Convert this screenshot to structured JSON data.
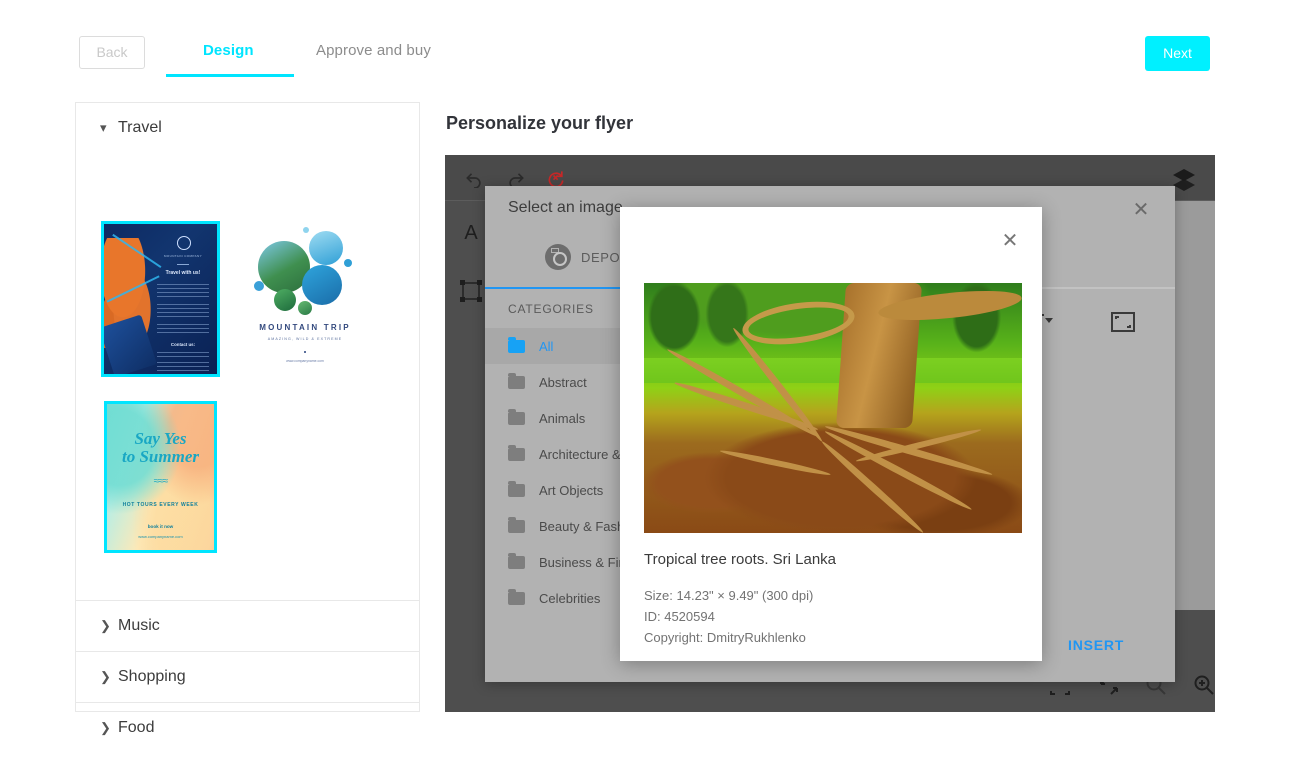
{
  "topbar": {
    "back_label": "Back",
    "tabs": [
      {
        "label": "Design",
        "active": true
      },
      {
        "label": "Approve and buy",
        "active": false
      }
    ],
    "next_label": "Next",
    "accent_color": "#00e5ff"
  },
  "sidebar": {
    "sections": [
      {
        "label": "Travel",
        "expanded": true,
        "caret": "chevron-down-icon"
      },
      {
        "label": "Music",
        "expanded": false,
        "caret": "chevron-right-icon"
      },
      {
        "label": "Shopping",
        "expanded": false,
        "caret": "chevron-right-icon"
      },
      {
        "label": "Food",
        "expanded": false,
        "caret": "chevron-right-icon"
      }
    ],
    "templates": [
      {
        "name": "travel-with-us-flyer",
        "selected": true,
        "headline": "Travel with us!",
        "brand": "MOUNTAIN COMPANY",
        "contact_label": "Contact us:"
      },
      {
        "name": "mountain-trip-flyer",
        "selected": false,
        "title": "MOUNTAIN TRIP",
        "subtitle": "AMAZING, WILD & EXTREME",
        "url": "www.companyname.com"
      },
      {
        "name": "say-yes-to-summer-flyer",
        "selected": true,
        "title_line1": "Say Yes",
        "title_line2": "to Summer",
        "waves": "≈≈≈",
        "tagline": "HOT TOURS EVERY WEEK",
        "cta": "book it now",
        "url": "www.companyname.com"
      }
    ]
  },
  "main": {
    "title": "Personalize your flyer"
  },
  "editor": {
    "tools": [
      {
        "name": "undo-icon",
        "label": "Undo"
      },
      {
        "name": "redo-icon",
        "label": "Redo"
      },
      {
        "name": "reset-icon",
        "label": "Reset",
        "color": "#c62828"
      },
      {
        "name": "text-tool-icon",
        "label": "A"
      },
      {
        "name": "shape-tool-icon",
        "label": "Shape"
      },
      {
        "name": "layers-icon",
        "label": "Layers"
      }
    ],
    "bottom_tools": [
      {
        "name": "fit-to-screen-icon",
        "label": "Fit to screen"
      },
      {
        "name": "shrink-icon",
        "label": "Shrink"
      },
      {
        "name": "zoom-out-icon",
        "label": "Zoom out"
      },
      {
        "name": "zoom-in-icon",
        "label": "Zoom in"
      }
    ]
  },
  "select_image_modal": {
    "title": "Select an image",
    "close_icon": "close-icon",
    "tab": {
      "label": "DEPOSITPHOTOS",
      "icon": "camera-icon",
      "active": true
    },
    "categories_header": "CATEGORIES",
    "categories": [
      {
        "label": "All",
        "active": true
      },
      {
        "label": "Abstract",
        "active": false
      },
      {
        "label": "Animals",
        "active": false
      },
      {
        "label": "Architecture & Buildings",
        "active": false
      },
      {
        "label": "Art Objects",
        "active": false
      },
      {
        "label": "Beauty & Fashion",
        "active": false
      },
      {
        "label": "Business & Finance",
        "active": false
      },
      {
        "label": "Celebrities",
        "active": false
      }
    ],
    "insert_label": "INSERT",
    "sort_icon": "sort-icon",
    "fit_icon": "fit-icon",
    "accent_color": "#2196f3"
  },
  "image_detail": {
    "close_icon": "close-icon",
    "image_alt": "Tropical tree roots photograph",
    "title": "Tropical tree roots. Sri Lanka",
    "size": "Size: 14.23\" × 9.49\" (300 dpi)",
    "id": "ID: 4520594",
    "copyright": "Copyright: DmitryRukhlenko"
  }
}
